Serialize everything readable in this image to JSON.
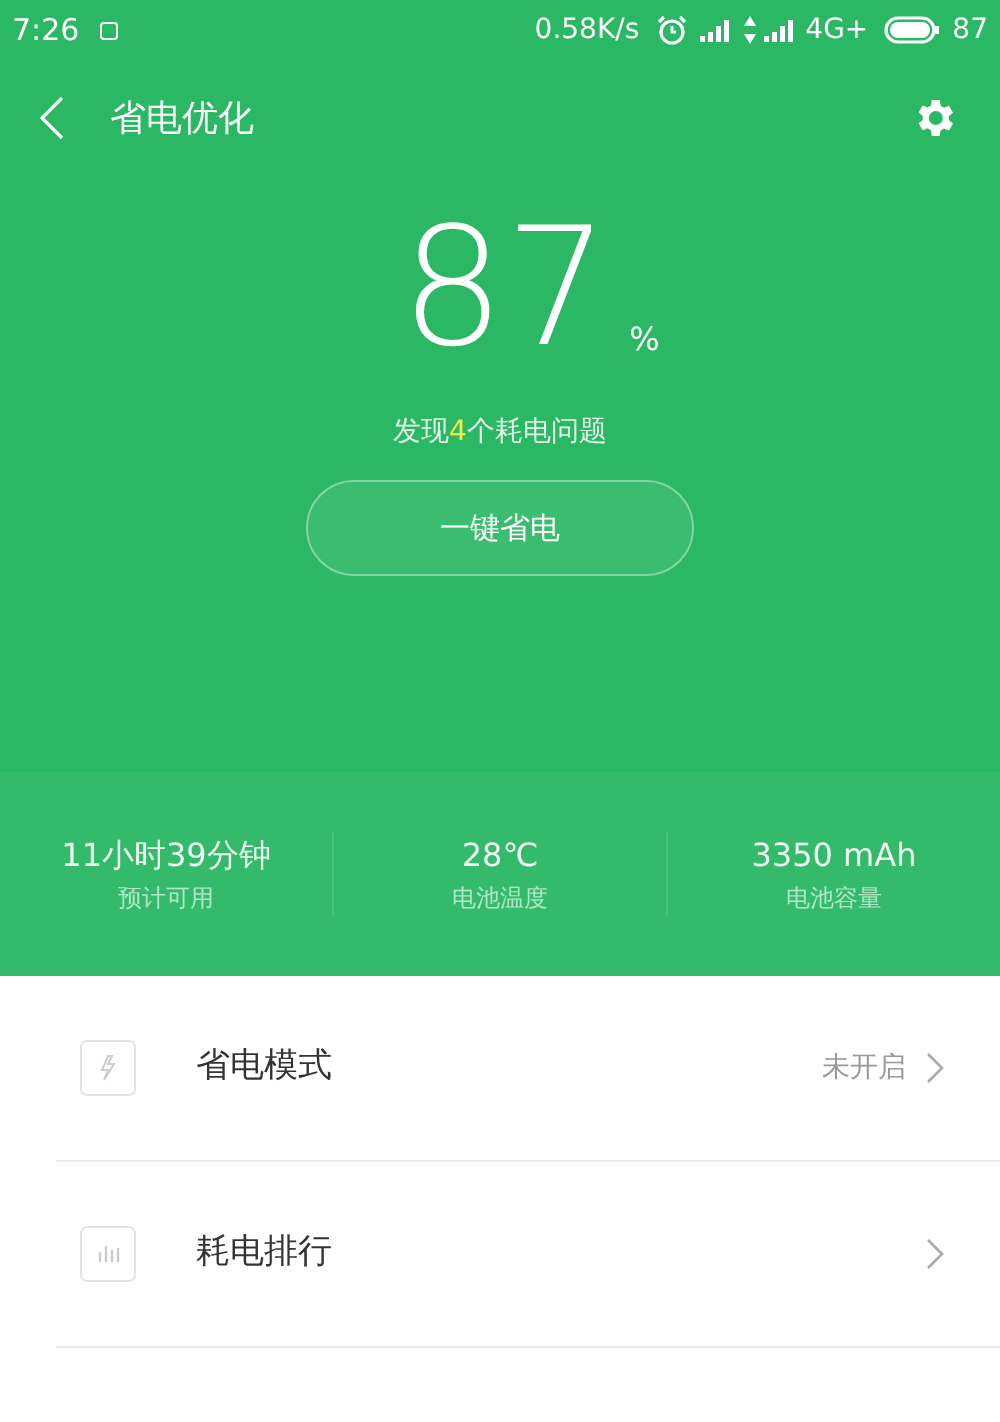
{
  "status_bar": {
    "time": "7:26",
    "speed": "0.58K/s",
    "network": "4G+",
    "battery": "87"
  },
  "header": {
    "title": "省电优化"
  },
  "score": {
    "value": "87",
    "unit": "%"
  },
  "issues": {
    "before": "发现",
    "count": "4",
    "after": "个耗电问题"
  },
  "action_button": "一键省电",
  "stats": [
    {
      "value": "11小时39分钟",
      "label": "预计可用"
    },
    {
      "value": "28℃",
      "label": "电池温度"
    },
    {
      "value": "3350 mAh",
      "label": "电池容量"
    }
  ],
  "menu": [
    {
      "kind": "mode",
      "title": "省电模式",
      "status": "未开启"
    },
    {
      "kind": "ranking",
      "title": "耗电排行"
    }
  ]
}
